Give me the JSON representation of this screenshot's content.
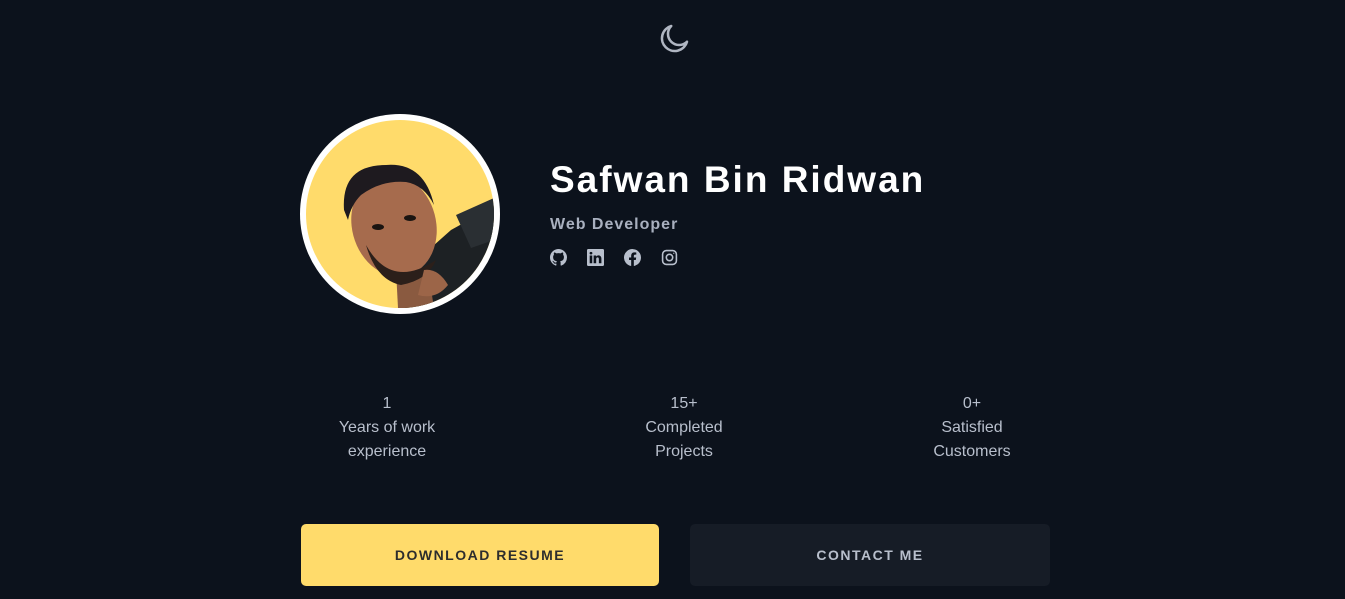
{
  "theme_toggle": {
    "icon": "moon-icon"
  },
  "profile": {
    "name": "Safwan Bin Ridwan",
    "role": "Web Developer",
    "avatar": {
      "background": "#ffdb6b"
    },
    "socials": [
      {
        "icon": "github-icon"
      },
      {
        "icon": "linkedin-icon"
      },
      {
        "icon": "facebook-icon"
      },
      {
        "icon": "instagram-icon"
      }
    ]
  },
  "stats": [
    {
      "value": "1",
      "label": "Years of work experience"
    },
    {
      "value": "15+",
      "label": "Completed Projects"
    },
    {
      "value": "0+",
      "label": "Satisfied Customers"
    }
  ],
  "actions": {
    "download_resume": "DOWNLOAD RESUME",
    "contact_me": "CONTACT ME"
  },
  "colors": {
    "background": "#0c121c",
    "accent": "#ffdb6b",
    "secondary_button": "#161c26",
    "muted_text": "#b8bfcc"
  }
}
